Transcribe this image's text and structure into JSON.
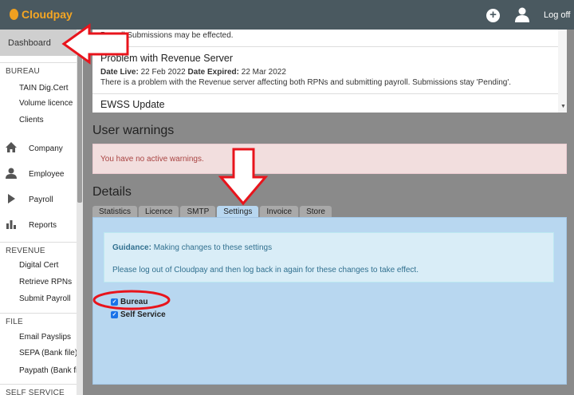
{
  "header": {
    "app_name": "Cloudpay",
    "logoff_label": "Log off"
  },
  "sidebar": {
    "dashboard": "Dashboard",
    "sections": {
      "bureau": "BUREAU",
      "revenue": "REVENUE",
      "file": "FILE",
      "self_service": "SELF SERVICE"
    },
    "bureau_items": [
      "TAIN Dig.Cert",
      "Volume licence",
      "Clients"
    ],
    "icon_items": [
      {
        "label": "Company",
        "icon": "home-icon"
      },
      {
        "label": "Employee",
        "icon": "user-icon"
      },
      {
        "label": "Payroll",
        "icon": "play-icon"
      },
      {
        "label": "Reports",
        "icon": "bar-chart-icon"
      }
    ],
    "revenue_items": [
      "Digital Cert",
      "Retrieve RPNs",
      "Submit Payroll"
    ],
    "file_items": [
      "Email Payslips",
      "SEPA (Bank file)",
      "Paypath (Bank file)"
    ]
  },
  "notices": {
    "partial_line": "Payroll Submissions may be effected.",
    "items": [
      {
        "title": "Problem with Revenue Server",
        "date_live_label": "Date Live:",
        "date_live": "22 Feb 2022",
        "date_expired_label": "Date Expired:",
        "date_expired": "22 Mar 2022",
        "body": "There is a problem with the Revenue server affecting both RPNs and submitting payroll. Submissions stay 'Pending'."
      },
      {
        "title": "EWSS Update"
      }
    ]
  },
  "warnings": {
    "heading": "User warnings",
    "message": "You have no active warnings."
  },
  "details": {
    "heading": "Details",
    "tabs": [
      "Statistics",
      "Licence",
      "SMTP",
      "Settings",
      "Invoice",
      "Store"
    ],
    "active_tab": "Settings",
    "guidance_label": "Guidance:",
    "guidance_text": "Making changes to these settings",
    "guidance_note": "Please log out of Cloudpay and then log back in again for these changes to take effect.",
    "checkboxes": [
      {
        "label": "Bureau",
        "checked": true
      },
      {
        "label": "Self Service",
        "checked": true
      }
    ]
  },
  "colors": {
    "topbar": "#4a5960",
    "brand": "#f5a623",
    "annotation": "#e8141c",
    "panel": "#b8d7f0"
  }
}
